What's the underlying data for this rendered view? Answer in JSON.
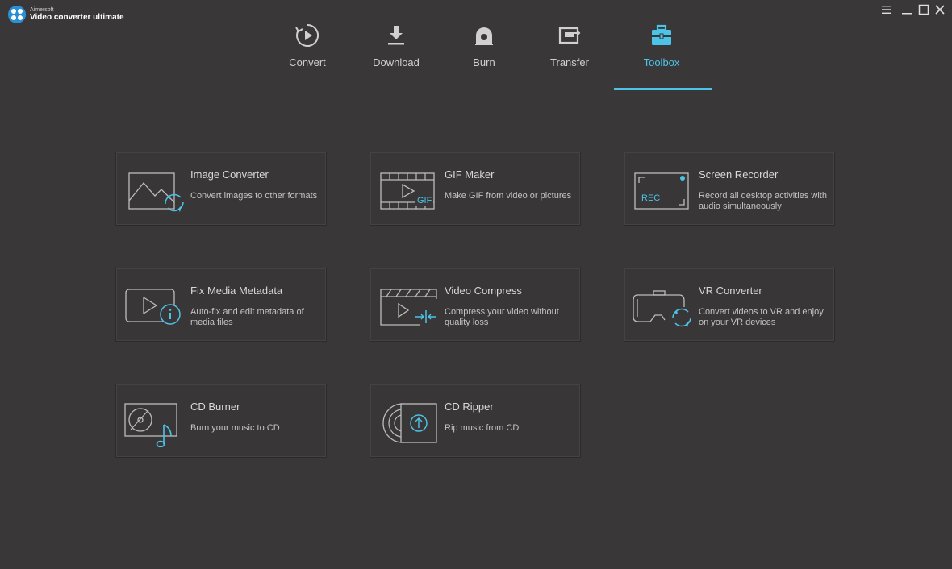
{
  "app": {
    "company": "Aimersoft",
    "product": "Video converter ultimate"
  },
  "window_controls": [
    {
      "name": "menu-icon"
    },
    {
      "name": "minimize-icon"
    },
    {
      "name": "maximize-icon"
    },
    {
      "name": "close-icon"
    }
  ],
  "nav": {
    "items": [
      {
        "label": "Convert",
        "icon": "convert-icon"
      },
      {
        "label": "Download",
        "icon": "download-icon"
      },
      {
        "label": "Burn",
        "icon": "burn-icon"
      },
      {
        "label": "Transfer",
        "icon": "transfer-icon"
      },
      {
        "label": "Toolbox",
        "icon": "toolbox-icon",
        "active": true
      }
    ]
  },
  "tools": [
    {
      "title": "Image Converter",
      "desc": "Convert images to other formats",
      "icon": "image-converter-icon"
    },
    {
      "title": "GIF Maker",
      "desc": "Make GIF from video or pictures",
      "icon": "gif-maker-icon",
      "badge": "GIF"
    },
    {
      "title": "Screen Recorder",
      "desc": "Record all desktop activities with audio simultaneously",
      "icon": "screen-recorder-icon",
      "badge": "REC"
    },
    {
      "title": "Fix Media Metadata",
      "desc": "Auto-fix and edit metadata of media files",
      "icon": "fix-metadata-icon"
    },
    {
      "title": "Video Compress",
      "desc": "Compress your video without quality loss",
      "icon": "video-compress-icon"
    },
    {
      "title": "VR Converter",
      "desc": "Convert videos to VR and enjoy on your VR devices",
      "icon": "vr-converter-icon"
    },
    {
      "title": "CD Burner",
      "desc": "Burn your music to CD",
      "icon": "cd-burner-icon"
    },
    {
      "title": "CD Ripper",
      "desc": "Rip music from CD",
      "icon": "cd-ripper-icon"
    }
  ],
  "colors": {
    "background": "#3a3738",
    "accent": "#4cc4e8",
    "text": "#cfcfcf"
  }
}
